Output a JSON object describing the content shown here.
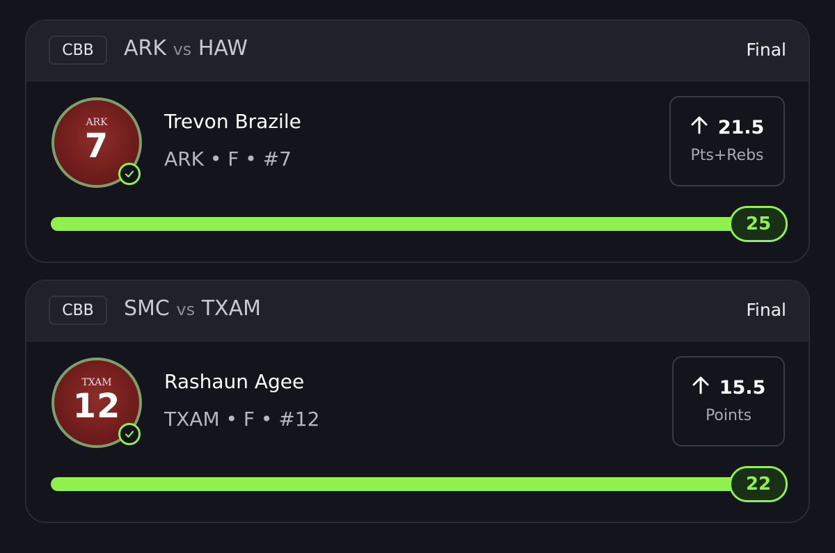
{
  "colors": {
    "background": "#14141d",
    "header": "#212129",
    "accent_green": "#8ff04e",
    "jersey_red": "#6e1d1c"
  },
  "cards": [
    {
      "league": "CBB",
      "home": "ARK",
      "vs": "vs",
      "away": "HAW",
      "status": "Final",
      "jersey_team": "ARK",
      "jersey_number": "7",
      "player_name": "Trevon Brazile",
      "player_info": "ARK • F • #7",
      "direction_icon": "arrow-up-icon",
      "line": "21.5",
      "stat": "Pts+Rebs",
      "result": "25",
      "progress": 1.0,
      "status_icon": "check-circle-icon"
    },
    {
      "league": "CBB",
      "home": "SMC",
      "vs": "vs",
      "away": "TXAM",
      "status": "Final",
      "jersey_team": "TXAM",
      "jersey_number": "12",
      "player_name": "Rashaun Agee",
      "player_info": "TXAM • F • #12",
      "direction_icon": "arrow-up-icon",
      "line": "15.5",
      "stat": "Points",
      "result": "22",
      "progress": 1.0,
      "status_icon": "check-circle-icon"
    }
  ]
}
